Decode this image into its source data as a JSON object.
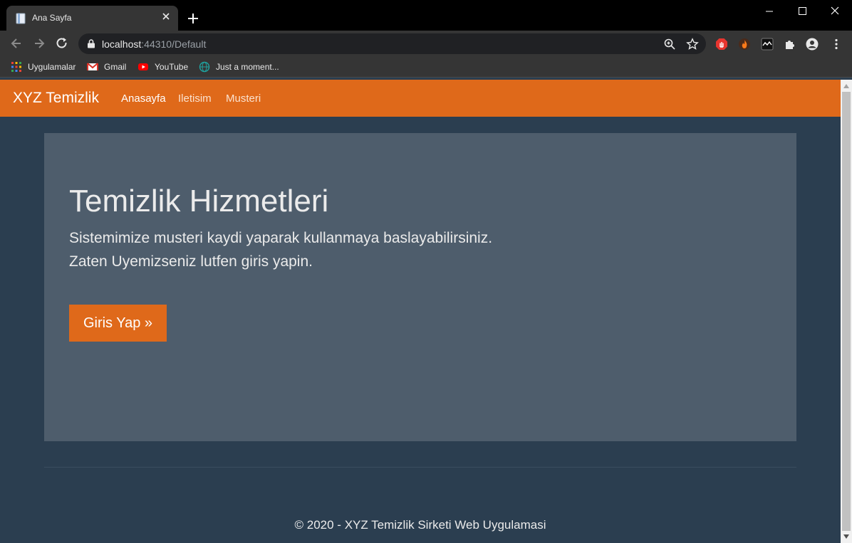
{
  "browser": {
    "tab_title": "Ana Sayfa",
    "url_host": "localhost",
    "url_rest": ":44310/Default",
    "bookmarks": [
      {
        "label": "Uygulamalar",
        "icon": "apps-grid-icon"
      },
      {
        "label": "Gmail",
        "icon": "gmail-icon"
      },
      {
        "label": "YouTube",
        "icon": "youtube-icon"
      },
      {
        "label": "Just a moment...",
        "icon": "globe-icon"
      }
    ]
  },
  "navbar": {
    "brand": "XYZ Temizlik",
    "links": [
      "Anasayfa",
      "Iletisim",
      "Musteri"
    ],
    "active": "Anasayfa",
    "color": "#df691a"
  },
  "jumbotron": {
    "title": "Temizlik Hizmetleri",
    "line1": "Sistemimize musteri kaydi yaparak kullanmaya baslayabilirsiniz.",
    "line2": "Zaten Uyemizseniz lutfen giris yapin.",
    "button": "Giris Yap »"
  },
  "footer": {
    "text": "© 2020 - XYZ Temizlik Sirketi Web Uygulamasi"
  }
}
